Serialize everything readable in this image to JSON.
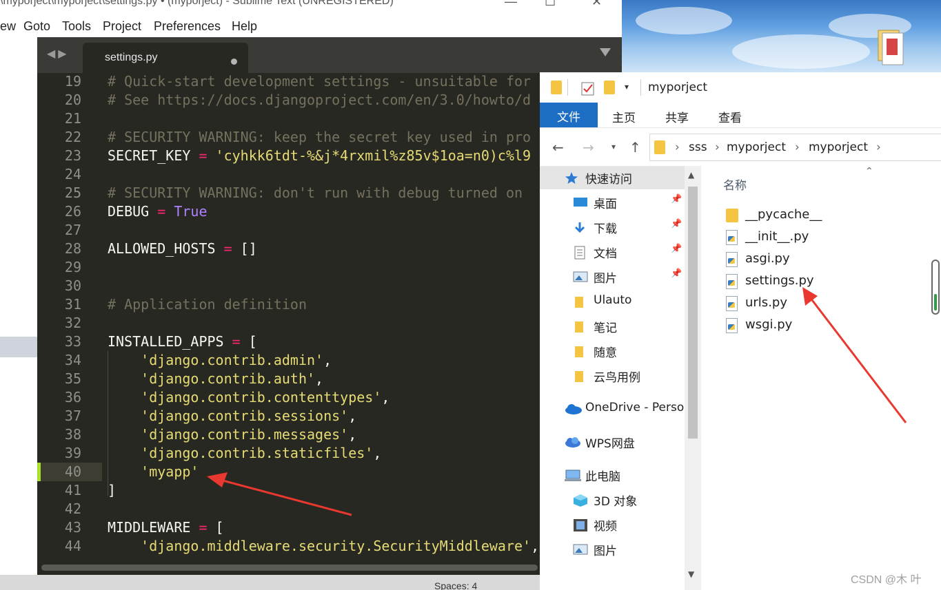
{
  "sublime": {
    "title": "\\myporject\\myporject\\settings.py • (myporject) - Sublime Text (UNREGISTERED)",
    "menu": [
      "ew",
      "Goto",
      "Tools",
      "Project",
      "Preferences",
      "Help"
    ],
    "tab": {
      "label": "settings.py"
    },
    "status": {
      "spaces": "Spaces: 4"
    },
    "lines": [
      {
        "n": "19",
        "text": "# Quick-start development settings - unsuitable for"
      },
      {
        "n": "20",
        "text": "# See https://docs.djangoproject.com/en/3.0/howto/d"
      },
      {
        "n": "21",
        "text": ""
      },
      {
        "n": "22",
        "text": "# SECURITY WARNING: keep the secret key used in pro"
      },
      {
        "n": "23",
        "pre": "SECRET_KEY ",
        "op": "=",
        "str": " 'cyhkk6tdt-%&j*4rxmil%z85v$1oa=n0)c%l9"
      },
      {
        "n": "24",
        "text": ""
      },
      {
        "n": "25",
        "text": "# SECURITY WARNING: don't run with debug turned on"
      },
      {
        "n": "26",
        "pre": "DEBUG ",
        "op": "=",
        "kw": " True"
      },
      {
        "n": "27",
        "text": ""
      },
      {
        "n": "28",
        "pre": "ALLOWED_HOSTS ",
        "op": "=",
        "post": " []"
      },
      {
        "n": "29",
        "text": ""
      },
      {
        "n": "30",
        "text": ""
      },
      {
        "n": "31",
        "text": "# Application definition"
      },
      {
        "n": "32",
        "text": ""
      },
      {
        "n": "33",
        "pre": "INSTALLED_APPS ",
        "op": "=",
        "post": " ["
      },
      {
        "n": "34",
        "indent": "    ",
        "str": "'django.contrib.admin'",
        "post": ","
      },
      {
        "n": "35",
        "indent": "    ",
        "str": "'django.contrib.auth'",
        "post": ","
      },
      {
        "n": "36",
        "indent": "    ",
        "str": "'django.contrib.contenttypes'",
        "post": ","
      },
      {
        "n": "37",
        "indent": "    ",
        "str": "'django.contrib.sessions'",
        "post": ","
      },
      {
        "n": "38",
        "indent": "    ",
        "str": "'django.contrib.messages'",
        "post": ","
      },
      {
        "n": "39",
        "indent": "    ",
        "str": "'django.contrib.staticfiles'",
        "post": ","
      },
      {
        "n": "40",
        "indent": "    ",
        "str": "'myapp'"
      },
      {
        "n": "41",
        "pre": "]"
      },
      {
        "n": "42",
        "text": ""
      },
      {
        "n": "43",
        "pre": "MIDDLEWARE ",
        "op": "=",
        "post": " ["
      },
      {
        "n": "44",
        "indent": "    ",
        "str": "'django.middleware.security.SecurityMiddleware'",
        "post": ","
      }
    ]
  },
  "explorer": {
    "title": "myporject",
    "ribbon": {
      "active": "文件",
      "tabs": [
        "主页",
        "共享",
        "查看"
      ]
    },
    "breadcrumb": [
      "sss",
      "myporject",
      "myporject"
    ],
    "nav_items": [
      {
        "label": "快速访问",
        "icon": "star-icon",
        "pinned": false
      },
      {
        "label": "桌面",
        "icon": "desktop-icon",
        "pinned": true
      },
      {
        "label": "下载",
        "icon": "download-icon",
        "pinned": true
      },
      {
        "label": "文档",
        "icon": "document-icon",
        "pinned": true
      },
      {
        "label": "图片",
        "icon": "picture-icon",
        "pinned": true
      },
      {
        "label": "Ulauto",
        "icon": "folder-icon",
        "pinned": false
      },
      {
        "label": "笔记",
        "icon": "folder-icon",
        "pinned": false
      },
      {
        "label": "随意",
        "icon": "folder-icon",
        "pinned": false
      },
      {
        "label": "云鸟用例",
        "icon": "folder-icon",
        "pinned": false
      },
      {
        "label": "OneDrive - Perso",
        "icon": "onedrive-icon",
        "pinned": false
      },
      {
        "label": "WPS网盘",
        "icon": "cloud-icon",
        "pinned": false
      },
      {
        "label": "此电脑",
        "icon": "computer-icon",
        "pinned": false
      },
      {
        "label": "3D 对象",
        "icon": "cube-icon",
        "pinned": false
      },
      {
        "label": "视频",
        "icon": "video-icon",
        "pinned": false
      },
      {
        "label": "图片",
        "icon": "picture-icon",
        "pinned": false
      }
    ],
    "column_header": "名称",
    "files": [
      {
        "name": "__pycache__",
        "icon": "folder-icon"
      },
      {
        "name": "__init__.py",
        "icon": "python-file-icon"
      },
      {
        "name": "asgi.py",
        "icon": "python-file-icon"
      },
      {
        "name": "settings.py",
        "icon": "python-file-icon"
      },
      {
        "name": "urls.py",
        "icon": "python-file-icon"
      },
      {
        "name": "wsgi.py",
        "icon": "python-file-icon"
      }
    ]
  },
  "watermark": "CSDN @木 叶",
  "colors": {
    "editor_bg": "#272822",
    "string": "#e6db74",
    "operator": "#f92672",
    "comment": "#75715e",
    "keyword": "#ae81ff",
    "explorer_accent": "#1c6ec4",
    "annotation_arrow": "#e8382f"
  }
}
